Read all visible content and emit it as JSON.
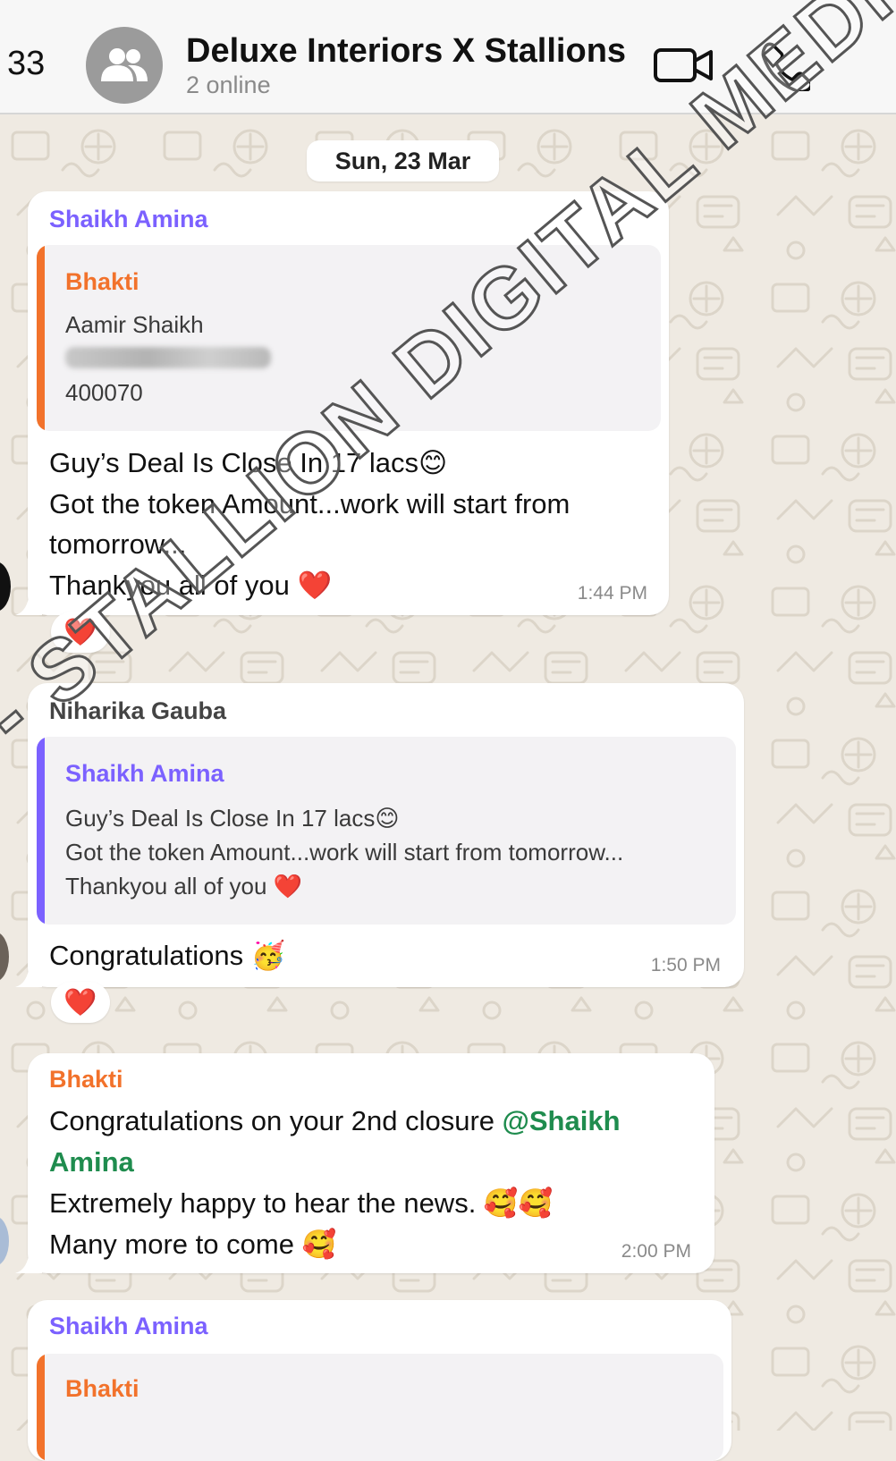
{
  "header": {
    "back_count": "33",
    "title": "Deluxe Interiors X Stallions",
    "subtitle": "2 online"
  },
  "date_separator": "Sun, 23 Mar",
  "messages": [
    {
      "sender": "Shaikh Amina",
      "sender_color": "#7b61ff",
      "quote": {
        "name": "Bhakti",
        "name_color": "#f2722b",
        "lines": [
          "Aamir Shaikh",
          "400070"
        ]
      },
      "lines": [
        "Guy’s Deal Is Close In 17 lacs😊",
        "Got the token Amount...work will start from",
        "tomorrow...",
        "Thankyou all of you ❤️"
      ],
      "time": "1:44 PM",
      "reaction": "❤️"
    },
    {
      "sender": "Niharika Gauba",
      "sender_color": "#444444",
      "quote": {
        "name": "Shaikh Amina",
        "name_color": "#7b61ff",
        "lines": [
          "Guy’s Deal Is Close In 17 lacs😊",
          "Got the token Amount...work will start from tomorrow...",
          "Thankyou all of you ❤️"
        ]
      },
      "lines": [
        "Congratulations 🥳"
      ],
      "time": "1:50 PM",
      "reaction": "❤️"
    },
    {
      "sender": "Bhakti",
      "sender_color": "#f2722b",
      "lines": [
        "Congratulations on your 2nd closure ",
        "Amina",
        "Extremely happy to hear the news. 🥰🥰",
        "Many more to come 🥰"
      ],
      "mention": "@Shaikh",
      "time": "2:00 PM"
    },
    {
      "sender": "Shaikh Amina",
      "sender_color": "#7b61ff",
      "quote": {
        "name": "Bhakti",
        "name_color": "#f2722b"
      }
    }
  ],
  "watermark": "- STALLION DIGITAL MEDI",
  "icons": {
    "avatar": "group-icon",
    "video": "video-camera-icon",
    "call": "phone-icon"
  }
}
